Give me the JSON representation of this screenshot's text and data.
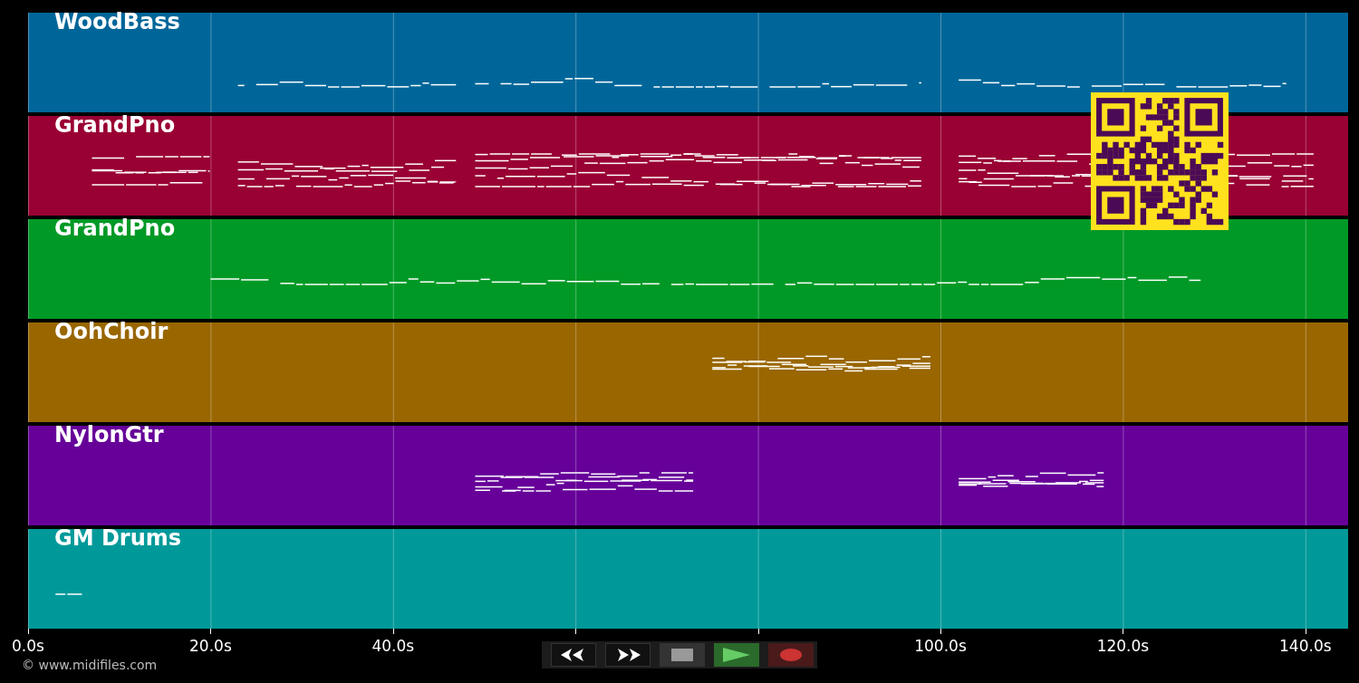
{
  "tracks": [
    {
      "name": "WoodBass",
      "color": "#006699"
    },
    {
      "name": "GrandPno",
      "color": "#990033"
    },
    {
      "name": "GrandPno",
      "color": "#009926"
    },
    {
      "name": "OohChoir",
      "color": "#996600"
    },
    {
      "name": "NylonGtr",
      "color": "#660099"
    },
    {
      "name": "GM Drums",
      "color": "#009999"
    }
  ],
  "time_axis": {
    "labels": [
      "0.0s",
      "20.0s",
      "40.0s",
      "100.0s",
      "120.0s",
      "140.0s"
    ]
  },
  "copyright": "© www.midifiles.com",
  "transport": [
    {
      "kind": "rewind"
    },
    {
      "kind": "forward"
    },
    {
      "kind": "stop"
    },
    {
      "kind": "play"
    },
    {
      "kind": "record"
    }
  ]
}
